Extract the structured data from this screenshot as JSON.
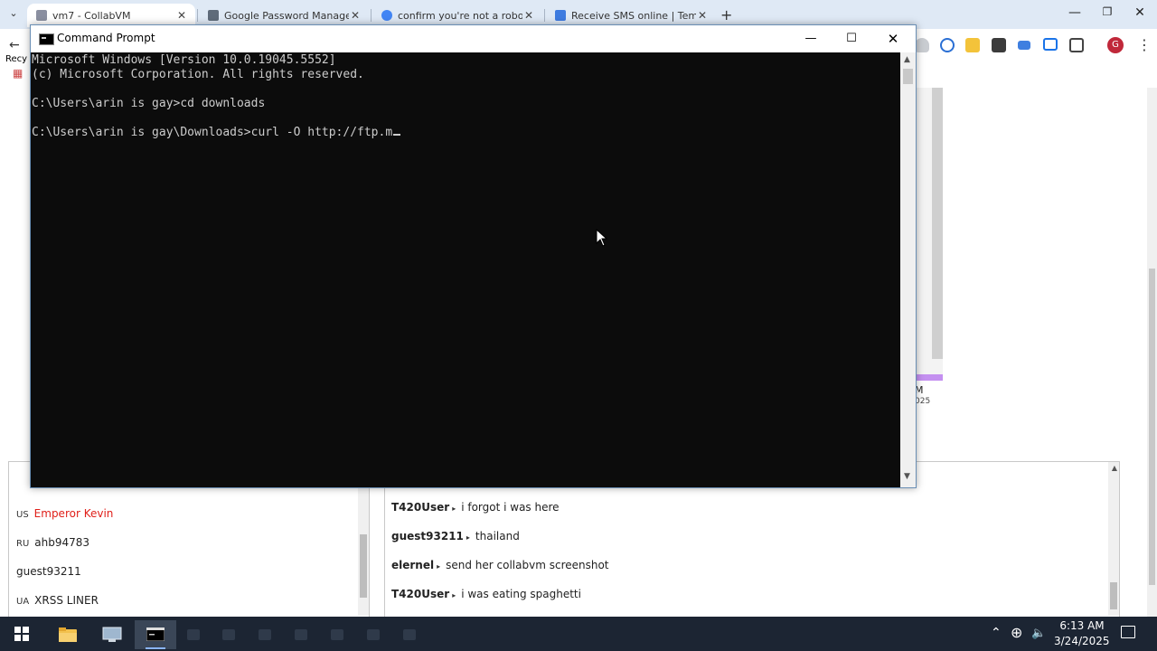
{
  "browser": {
    "tabs": [
      {
        "title": "vm7 - CollabVM",
        "active": true,
        "favicon_color": "#8a8fa0"
      },
      {
        "title": "Google Password Manager",
        "active": false,
        "favicon_color": "#5f6b7a"
      },
      {
        "title": "confirm you're not a robot goo",
        "active": false,
        "favicon_color": "#4285f4"
      },
      {
        "title": "Receive SMS online | Temporar",
        "active": false,
        "favicon_color": "#3d7be0"
      }
    ],
    "close_glyph": "✕",
    "new_tab_glyph": "+",
    "tab_menu_glyph": "⌄",
    "window_controls": {
      "minimize": "—",
      "maximize": "❐",
      "close": "✕"
    },
    "toolbar": {
      "back_glyph": "←",
      "recycle_label": "Recy",
      "apps_glyph": "▦",
      "profile_initial": "G",
      "menu_glyph": "⋮",
      "extension_icons": [
        "shield-icon",
        "refresh-icon",
        "star-icon",
        "puzzle-box-icon",
        "media-icon",
        "cast-icon",
        "extensions-icon"
      ]
    }
  },
  "page_fragments": {
    "line1": "M",
    "line2": "025"
  },
  "users_panel": {
    "header_icon": "person-icon",
    "users": [
      {
        "country": "US",
        "name": "Emperor Kevin",
        "highlight": true
      },
      {
        "country": "RU",
        "name": "ahb94783",
        "highlight": false
      },
      {
        "country": "",
        "name": "guest93211",
        "highlight": false
      },
      {
        "country": "UA",
        "name": "XRSS LINER",
        "highlight": false
      }
    ]
  },
  "chat_panel": {
    "arrow_glyph": "▸",
    "messages": [
      {
        "user": "T420User",
        "text": "i forgot i was here"
      },
      {
        "user": "guest93211",
        "text": "thailand"
      },
      {
        "user": "elernel",
        "text": "send her collabvm screenshot"
      },
      {
        "user": "T420User",
        "text": "i was eating spaghetti"
      }
    ]
  },
  "cmd": {
    "title": "Command Prompt",
    "buttons": {
      "minimize": "—",
      "maximize": "☐",
      "close": "✕"
    },
    "lines": [
      "Microsoft Windows [Version 10.0.19045.5552]",
      "(c) Microsoft Corporation. All rights reserved.",
      "",
      "C:\\Users\\arin is gay>cd downloads",
      "",
      "C:\\Users\\arin is gay\\Downloads>curl -O http://ftp.m"
    ],
    "scroll_up_glyph": "▲",
    "scroll_down_glyph": "▼"
  },
  "taskbar": {
    "tray_chevron": "⌃",
    "network_glyph": "⊕",
    "volume_glyph": "🔈",
    "time": "6:13 AM",
    "date": "3/24/2025"
  },
  "colors": {
    "console_bg": "#0c0c0c",
    "console_text": "#cccccc",
    "taskbar_bg": "#1c2533",
    "highlight_user": "#e0201a",
    "profile": "#c0283a"
  }
}
